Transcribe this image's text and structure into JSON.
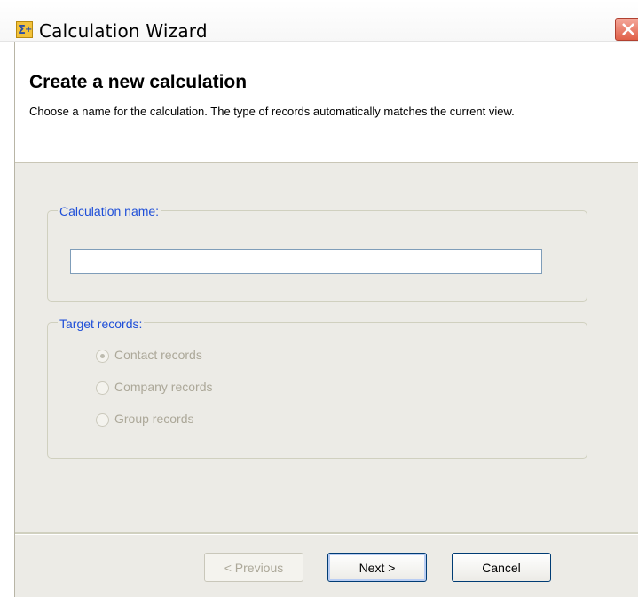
{
  "window": {
    "title": "Calculation Wizard",
    "icon": "sigma-plus-icon",
    "close_icon": "close-icon"
  },
  "header": {
    "title": "Create a new calculation",
    "description": "Choose a name for the calculation. The type of records automatically matches the current view."
  },
  "calculation_name": {
    "legend": "Calculation name:",
    "value": "",
    "placeholder": ""
  },
  "target_records": {
    "legend": "Target records:",
    "options": [
      {
        "label": "Contact records",
        "selected": true,
        "enabled": false
      },
      {
        "label": "Company records",
        "selected": false,
        "enabled": false
      },
      {
        "label": "Group records",
        "selected": false,
        "enabled": false
      }
    ]
  },
  "footer": {
    "previous_label": "< Previous",
    "next_label": "Next >",
    "cancel_label": "Cancel"
  },
  "colors": {
    "accent_legend": "#1f4fd8",
    "panel_background": "#ecebe6",
    "disabled_text": "#aca899"
  }
}
